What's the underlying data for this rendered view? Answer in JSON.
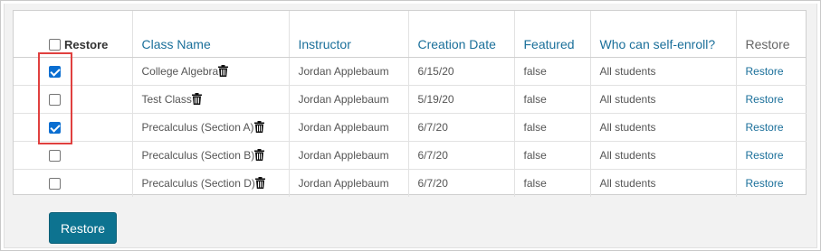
{
  "table": {
    "headers": {
      "select": "Restore",
      "class_name": "Class Name",
      "instructor": "Instructor",
      "creation_date": "Creation Date",
      "featured": "Featured",
      "self_enroll": "Who can self-enroll?",
      "restore": "Restore"
    },
    "rows": [
      {
        "checked": true,
        "class_name": "College Algebra",
        "instructor": "Jordan Applebaum",
        "creation_date": "6/15/20",
        "featured": "false",
        "self_enroll": "All students",
        "restore_link": "Restore"
      },
      {
        "checked": false,
        "class_name": "Test Class",
        "instructor": "Jordan Applebaum",
        "creation_date": "5/19/20",
        "featured": "false",
        "self_enroll": "All students",
        "restore_link": "Restore"
      },
      {
        "checked": true,
        "class_name": "Precalculus (Section A)",
        "instructor": "Jordan Applebaum",
        "creation_date": "6/7/20",
        "featured": "false",
        "self_enroll": "All students",
        "restore_link": "Restore"
      },
      {
        "checked": false,
        "class_name": "Precalculus (Section B)",
        "instructor": "Jordan Applebaum",
        "creation_date": "6/7/20",
        "featured": "false",
        "self_enroll": "All students",
        "restore_link": "Restore"
      },
      {
        "checked": false,
        "class_name": "Precalculus (Section D)",
        "instructor": "Jordan Applebaum",
        "creation_date": "6/7/20",
        "featured": "false",
        "self_enroll": "All students",
        "restore_link": "Restore"
      }
    ]
  },
  "footer": {
    "restore_button": "Restore"
  },
  "icons": {
    "row_delete": "trash-icon"
  },
  "colors": {
    "link": "#1a6f9a",
    "button_bg": "#0d7390",
    "highlight": "#e0403f",
    "checkbox_checked": "#0a6ed1"
  }
}
